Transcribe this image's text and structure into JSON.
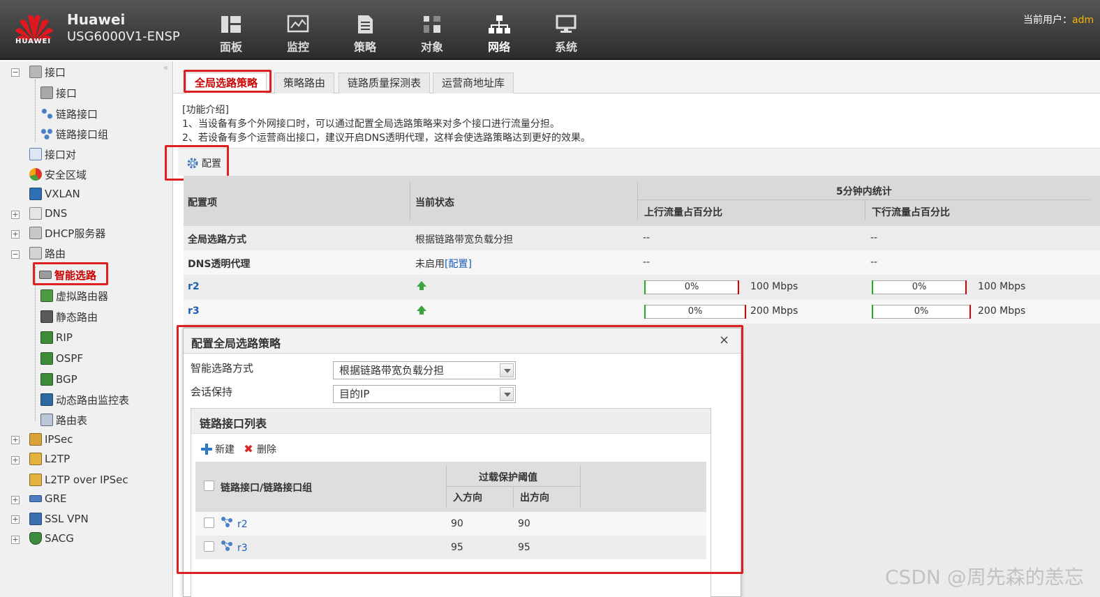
{
  "header": {
    "logo_text": "HUAWEI",
    "brand_line1": "Huawei",
    "brand_line2": "USG6000V1-ENSP",
    "nav": [
      {
        "label": "面板",
        "icon": "dashboard-icon"
      },
      {
        "label": "监控",
        "icon": "monitor-icon"
      },
      {
        "label": "策略",
        "icon": "policy-icon"
      },
      {
        "label": "对象",
        "icon": "object-icon"
      },
      {
        "label": "网络",
        "icon": "network-icon"
      },
      {
        "label": "系统",
        "icon": "system-icon"
      }
    ],
    "current_user_label": "当前用户：",
    "current_user": "adm"
  },
  "sidebar": {
    "collapse": "«",
    "items": [
      {
        "label": "接口",
        "icon": "interface-folder-icon"
      },
      {
        "label": "接口",
        "icon": "interface-icon"
      },
      {
        "label": "链路接口",
        "icon": "link-interface-icon"
      },
      {
        "label": "链路接口组",
        "icon": "link-interface-group-icon"
      },
      {
        "label": "接口对",
        "icon": "interface-pair-icon"
      },
      {
        "label": "安全区域",
        "icon": "security-zone-icon"
      },
      {
        "label": "VXLAN",
        "icon": "vxlan-icon"
      },
      {
        "label": "DNS",
        "icon": "dns-icon"
      },
      {
        "label": "DHCP服务器",
        "icon": "dhcp-icon"
      },
      {
        "label": "路由",
        "icon": "route-folder-icon"
      },
      {
        "label": "智能选路",
        "icon": "smart-routing-icon"
      },
      {
        "label": "虚拟路由器",
        "icon": "virtual-router-icon"
      },
      {
        "label": "静态路由",
        "icon": "static-route-icon"
      },
      {
        "label": "RIP",
        "icon": "rip-icon"
      },
      {
        "label": "OSPF",
        "icon": "ospf-icon"
      },
      {
        "label": "BGP",
        "icon": "bgp-icon"
      },
      {
        "label": "动态路由监控表",
        "icon": "dynamic-route-monitor-icon"
      },
      {
        "label": "路由表",
        "icon": "route-table-icon"
      },
      {
        "label": "IPSec",
        "icon": "ipsec-icon"
      },
      {
        "label": "L2TP",
        "icon": "l2tp-icon"
      },
      {
        "label": "L2TP over IPSec",
        "icon": "l2tp-ipsec-icon"
      },
      {
        "label": "GRE",
        "icon": "gre-icon"
      },
      {
        "label": "SSL VPN",
        "icon": "ssl-vpn-icon"
      },
      {
        "label": "SACG",
        "icon": "sacg-icon"
      }
    ]
  },
  "tabs": [
    "全局选路策略",
    "策略路由",
    "链路质量探测表",
    "运营商地址库"
  ],
  "intro": {
    "title": "[功能介绍]",
    "line1": "1、当设备有多个外网接口时，可以通过配置全局选路策略来对多个接口进行流量分担。",
    "line2": "2、若设备有多个运营商出接口，建议开启DNS透明代理，这样会使选路策略达到更好的效果。"
  },
  "config_button": "配置",
  "grid": {
    "headers": {
      "item": "配置项",
      "status": "当前状态",
      "stats": "5分钟内统计",
      "up": "上行流量占百分比",
      "down": "下行流量占百分比"
    },
    "rows": [
      {
        "item": "全局选路方式",
        "status": "根据链路带宽负载分担",
        "up": "--",
        "down": "--"
      },
      {
        "item": "DNS透明代理",
        "status": "未启用",
        "status_link": "[配置]",
        "up": "--",
        "down": "--"
      },
      {
        "item": "r2",
        "up_pct": "0%",
        "up_bw": "100 Mbps",
        "down_pct": "0%",
        "down_bw": "100 Mbps"
      },
      {
        "item": "r3",
        "up_pct": "0%",
        "up_bw": "200 Mbps",
        "down_pct": "0%",
        "down_bw": "200 Mbps"
      }
    ]
  },
  "dialog": {
    "title": "配置全局选路策略",
    "close": "×",
    "mode_label": "智能选路方式",
    "mode_value": "根据链路带宽负载分担",
    "session_label": "会话保持",
    "session_value": "目的IP",
    "panel_title": "链路接口列表",
    "add_label": "新建",
    "delete_label": "删除",
    "table": {
      "col_iface": "链路接口/链路接口组",
      "col_overload": "过载保护阈值",
      "col_in": "入方向",
      "col_out": "出方向",
      "rows": [
        {
          "iface": "r2",
          "in": "90",
          "out": "90"
        },
        {
          "iface": "r3",
          "in": "95",
          "out": "95"
        }
      ]
    }
  },
  "watermark": "CSDN @周先森的恙忘",
  "colors": {
    "accent_red": "#e02020",
    "link_blue": "#1a5fb4",
    "user_orange": "#f4b400"
  }
}
